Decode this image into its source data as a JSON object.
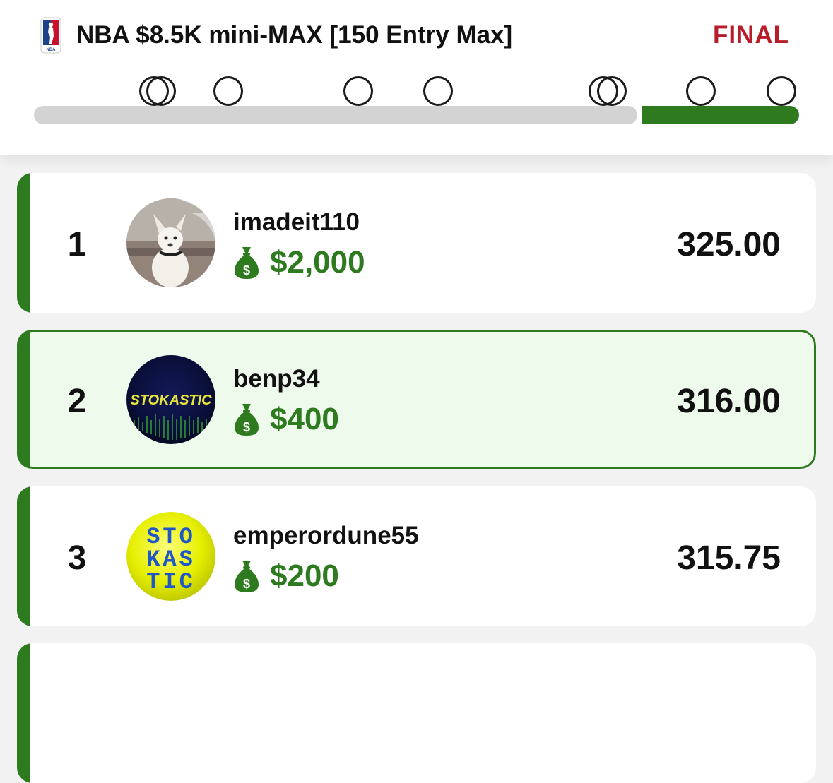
{
  "contest": {
    "title": "NBA $8.5K mini-MAX [150 Entry Max]",
    "status": "FINAL",
    "logo_icon": "nba-logo",
    "status_color": "#b81d2b"
  },
  "progress": {
    "fraction_complete": 0.79,
    "marker_count": 9,
    "fill_color": "#2d7a1f"
  },
  "entries": [
    {
      "rank": "1",
      "username": "imadeit110",
      "prize": "$2,000",
      "score": "325.00",
      "avatar_icon": "dog-photo-avatar",
      "highlighted": false
    },
    {
      "rank": "2",
      "username": "benp34",
      "prize": "$400",
      "score": "316.00",
      "avatar_icon": "stokastic-logo-avatar",
      "avatar_text": "STOKASTIC",
      "highlighted": true
    },
    {
      "rank": "3",
      "username": "emperordune55",
      "prize": "$200",
      "score": "315.75",
      "avatar_icon": "stokastic-block-logo-avatar",
      "avatar_text_lines": [
        "STO",
        "KAS",
        "TIC"
      ],
      "highlighted": false
    }
  ],
  "theme": {
    "accent_green": "#2d7a1f",
    "highlight_bg": "#eefaec",
    "money_green": "#2d7a1f"
  }
}
